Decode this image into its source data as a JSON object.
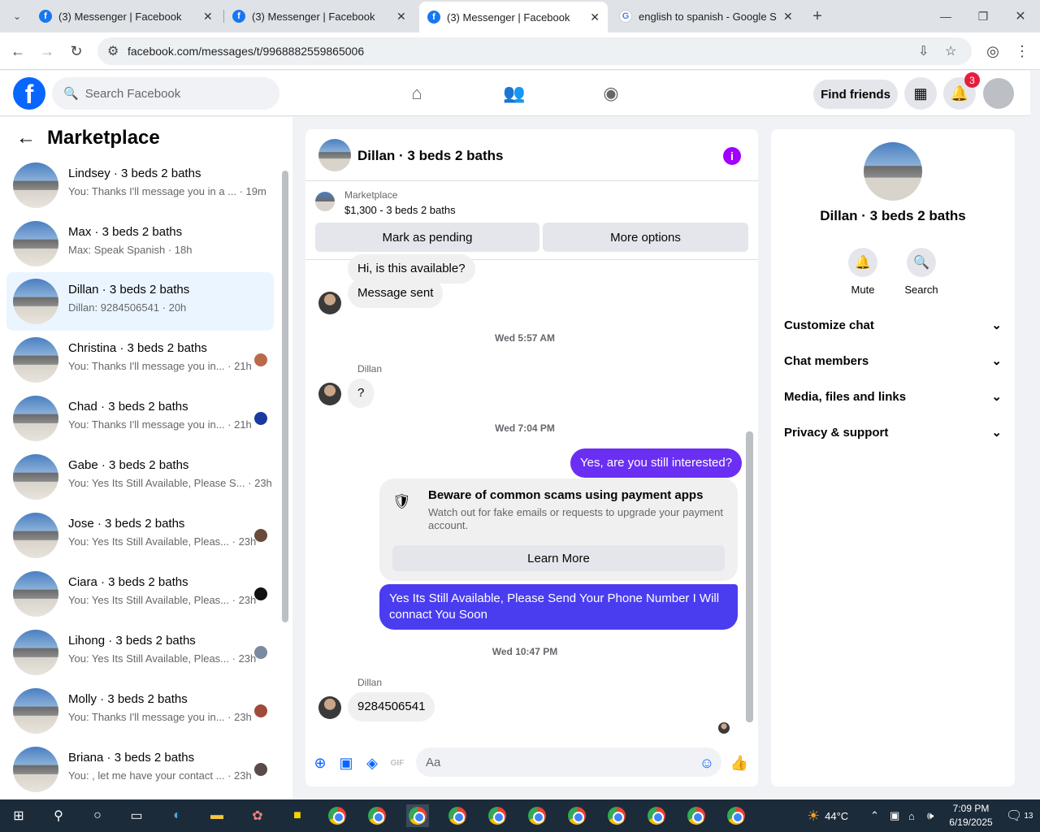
{
  "browser": {
    "tabs": [
      {
        "title": "(3) Messenger | Facebook"
      },
      {
        "title": "(3) Messenger | Facebook"
      },
      {
        "title": "(3) Messenger | Facebook"
      },
      {
        "title": "english to spanish - Google Search"
      }
    ],
    "url": "facebook.com/messages/t/9968882559865006"
  },
  "header": {
    "search_placeholder": "Search Facebook",
    "find_friends": "Find friends",
    "notification_count": "3"
  },
  "sidebar": {
    "title": "Marketplace",
    "conversations": [
      {
        "name": "Lindsey · 3 beds 2 baths",
        "snippet": "You: Thanks I'll message you in a ... · 19m"
      },
      {
        "name": "Max · 3 beds 2 baths",
        "snippet": "Max: Speak Spanish · 18h"
      },
      {
        "name": "Dillan · 3 beds 2 baths",
        "snippet": "Dillan: 9284506541 · 20h"
      },
      {
        "name": "Christina · 3 beds 2 baths",
        "snippet": "You: Thanks I'll message you in... · 21h"
      },
      {
        "name": "Chad · 3 beds 2 baths",
        "snippet": "You: Thanks I'll message you in... · 21h"
      },
      {
        "name": "Gabe · 3 beds 2 baths",
        "snippet": "You: Yes Its Still Available, Please S... · 23h"
      },
      {
        "name": "Jose · 3 beds 2 baths",
        "snippet": "You: Yes Its Still Available, Pleas... · 23h"
      },
      {
        "name": "Ciara · 3 beds 2 baths",
        "snippet": "You: Yes Its Still Available, Pleas... · 23h"
      },
      {
        "name": "Lihong · 3 beds 2 baths",
        "snippet": "You: Yes Its Still Available, Pleas... · 23h"
      },
      {
        "name": "Molly · 3 beds 2 baths",
        "snippet": "You: Thanks I'll message you in... · 23h"
      },
      {
        "name": "Briana · 3 beds 2 baths",
        "snippet": "You: , let me have your contact ... · 23h"
      }
    ]
  },
  "chat": {
    "title": "Dillan · 3 beds 2 baths",
    "marketplace_label": "Marketplace",
    "listing": "$1,300 - 3 beds 2 baths",
    "mark_pending": "Mark as pending",
    "more_options": "More options",
    "messages": {
      "m1": "Hi, is this available?",
      "m2": "Message sent",
      "ts1": "Wed 5:57 AM",
      "sender1": "Dillan",
      "m3": "?",
      "ts2": "Wed 7:04 PM",
      "m4": "Yes, are you still interested?",
      "warn_title": "Beware of common scams using payment apps",
      "warn_desc": "Watch out for fake emails or requests to upgrade your payment account.",
      "learn_more": "Learn More",
      "m5": "Yes Its Still Available, Please Send Your Phone Number I Will connact You Soon",
      "ts3": "Wed 10:47 PM",
      "sender2": "Dillan",
      "m6": "9284506541"
    },
    "compose_placeholder": "Aa",
    "gif_label": "GIF"
  },
  "details": {
    "name": "Dillan · 3 beds 2 baths",
    "mute": "Mute",
    "search": "Search",
    "items": [
      "Customize chat",
      "Chat members",
      "Media, files and links",
      "Privacy & support"
    ]
  },
  "taskbar": {
    "temp": "44°C",
    "time": "7:09 PM",
    "date": "6/19/2025",
    "notif": "13"
  }
}
